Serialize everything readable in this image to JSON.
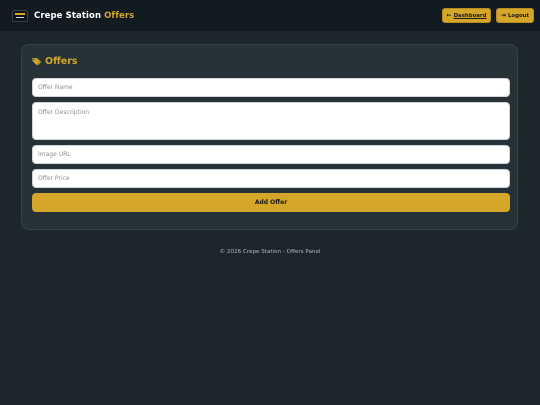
{
  "header": {
    "logo_icon": "crepe-station-logo-icon",
    "brand_name": "Crepe Station",
    "brand_accent": "Offers",
    "dashboard_icon": "←",
    "dashboard_label": "Dashboard",
    "logout_icon": "⇥",
    "logout_label": "Logout"
  },
  "card": {
    "title_icon": "tags-icon",
    "title": "Offers",
    "fields": {
      "name_placeholder": "Offer Name",
      "description_placeholder": "Offer Description",
      "image_placeholder": "Image URL",
      "price_placeholder": "Offer Price"
    },
    "submit_label": "Add Offer"
  },
  "footer": {
    "text": "© 2026 Crepe Station - Offers Panel"
  },
  "colors": {
    "accent": "#d4a62a",
    "background": "#1c262c",
    "header": "#121b20",
    "card": "#263238"
  }
}
